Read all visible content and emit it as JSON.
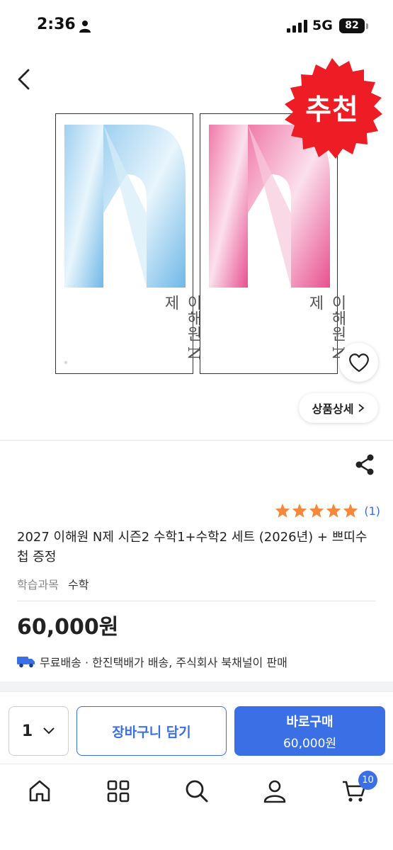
{
  "status_bar": {
    "time": "2:36",
    "network": "5G",
    "battery": "82"
  },
  "hero": {
    "badge": "추천",
    "book_sign": "이해원 N제",
    "detail_button": "상품상세"
  },
  "product": {
    "rating": 5,
    "review_count": "(1)",
    "title": "2027 이해원 N제 시즌2 수학1+수학2 세트 (2026년) + 쁘띠수첩 증정",
    "subject_label": "학습과목",
    "subject_value": "수학",
    "price": "60,000원",
    "shipping": "무료배송 · 한진택배가 배송, 주식회사 북채널이 판매"
  },
  "actions": {
    "quantity": "1",
    "cart_label": "장바구니 담기",
    "buy_label": "바로구매",
    "buy_price": "60,000원"
  },
  "tab_bar": {
    "items": [
      "home-icon",
      "grid-icon",
      "search-icon",
      "user-icon",
      "cart-icon"
    ],
    "cart_count": "10"
  },
  "colors": {
    "accent": "#3b6fe6",
    "badge_red": "#ee1c24",
    "star": "#f5883a"
  }
}
